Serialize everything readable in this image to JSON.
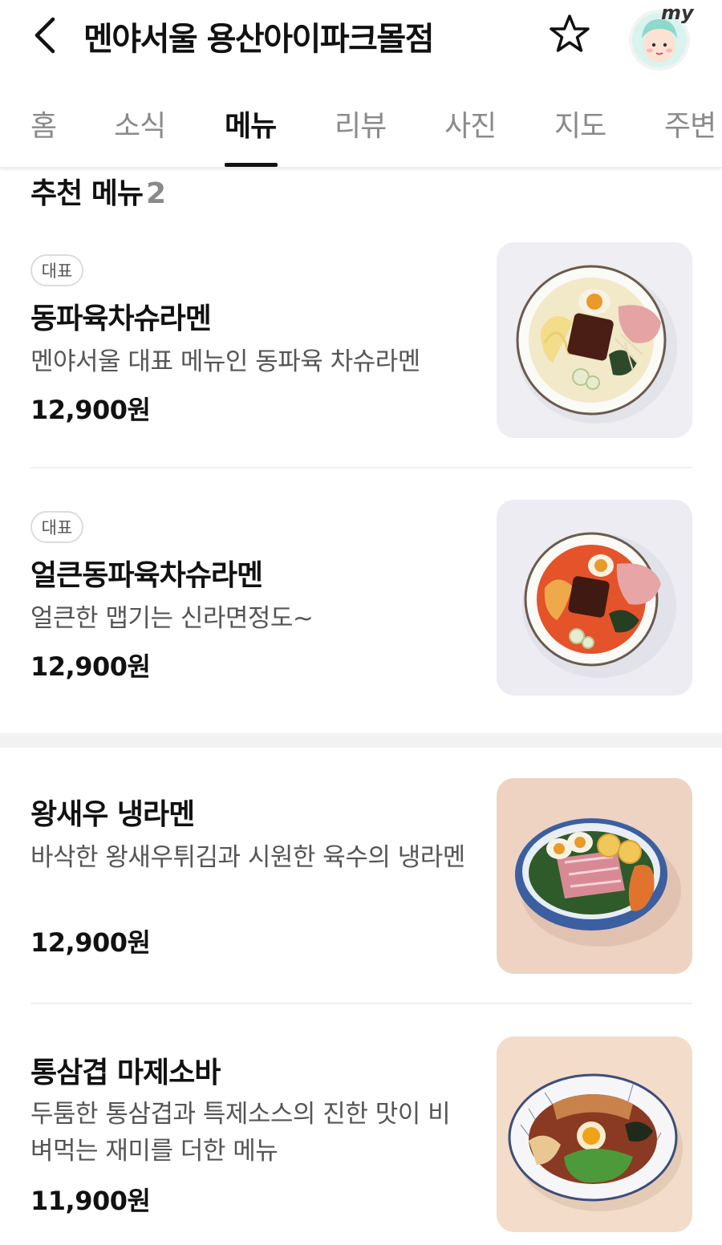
{
  "header": {
    "title": "멘야서울 용산아이파크몰점",
    "avatar_label": "my"
  },
  "tabs": [
    {
      "label": "홈"
    },
    {
      "label": "소식"
    },
    {
      "label": "메뉴",
      "active": true
    },
    {
      "label": "리뷰"
    },
    {
      "label": "사진"
    },
    {
      "label": "지도"
    },
    {
      "label": "주변"
    }
  ],
  "section": {
    "title": "추천 메뉴",
    "count": "2"
  },
  "menu_items": [
    {
      "badge": "대표",
      "name": "동파육차슈라멘",
      "description": "멘야서울 대표 메뉴인 동파육 차슈라멘",
      "price": "12,900원"
    },
    {
      "badge": "대표",
      "name": "얼큰동파육차슈라멘",
      "description": "얼큰한 맵기는 신라면정도~",
      "price": "12,900원"
    },
    {
      "name": "왕새우 냉라멘",
      "description": "바삭한 왕새우튀김과 시원한 육수의 냉라멘",
      "price": "12,900원"
    },
    {
      "name": "통삼겹 마제소바",
      "description": "두툼한 통삼겹과 특제소스의 진한 맛이 비벼먹는 재미를 더한 메뉴",
      "price": "11,900원"
    }
  ],
  "colors": {
    "text_primary": "#111111",
    "text_secondary": "#555555",
    "text_muted": "#8a8a8a",
    "avatar_bg": "#d9f3ee"
  }
}
